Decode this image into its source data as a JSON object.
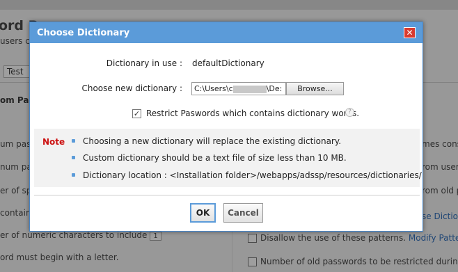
{
  "background": {
    "title": "ord P",
    "subtitle": "users c",
    "input_value": "Test",
    "section_label": "om Pas",
    "left_rows": [
      "um pas",
      "num pas",
      "er of sp",
      "contain",
      "er of numeric characters to include",
      "ord must begin with a letter."
    ],
    "numeric_value": "1",
    "right_rows": [
      "mes cons",
      "rom user",
      "rom old p",
      "se Dictio"
    ],
    "checkbox_rows": [
      {
        "text": "Disallow the use of these patterns.",
        "link": "Modify Patterns"
      },
      {
        "text": "Number of old passwords to be restricted during pa",
        "link": ""
      }
    ]
  },
  "dialog": {
    "title": "Choose Dictionary",
    "close_label": "✕",
    "dictionary_in_use_label": "Dictionary in use :",
    "dictionary_in_use_value": "defaultDictionary",
    "choose_new_label": "Choose new dictionary :",
    "file_path_start": "C:\\Users\\c",
    "file_path_end": "\\De:",
    "browse_label": "Browse...",
    "restrict_checked": true,
    "restrict_label": "Restrict Paswords which contains dictionary words.",
    "help_icon_glyph": "?",
    "note_label": "Note",
    "notes": [
      "Choosing a new dictionary will replace the existing dictionary.",
      "Custom dictionary should be a text file of size less than 10 MB.",
      "Dictionary location : <Installation folder>/webapps/adssp/resources/dictionaries/"
    ],
    "ok_label": "OK",
    "cancel_label": "Cancel"
  },
  "colors": {
    "titlebar": "#5b9bd9",
    "close_button": "#d93b2f",
    "note_label": "#cc1111",
    "link": "#1a5fb4"
  },
  "icons": {
    "close": "close-icon",
    "help": "help-icon",
    "checkbox": "checkmark-icon"
  }
}
